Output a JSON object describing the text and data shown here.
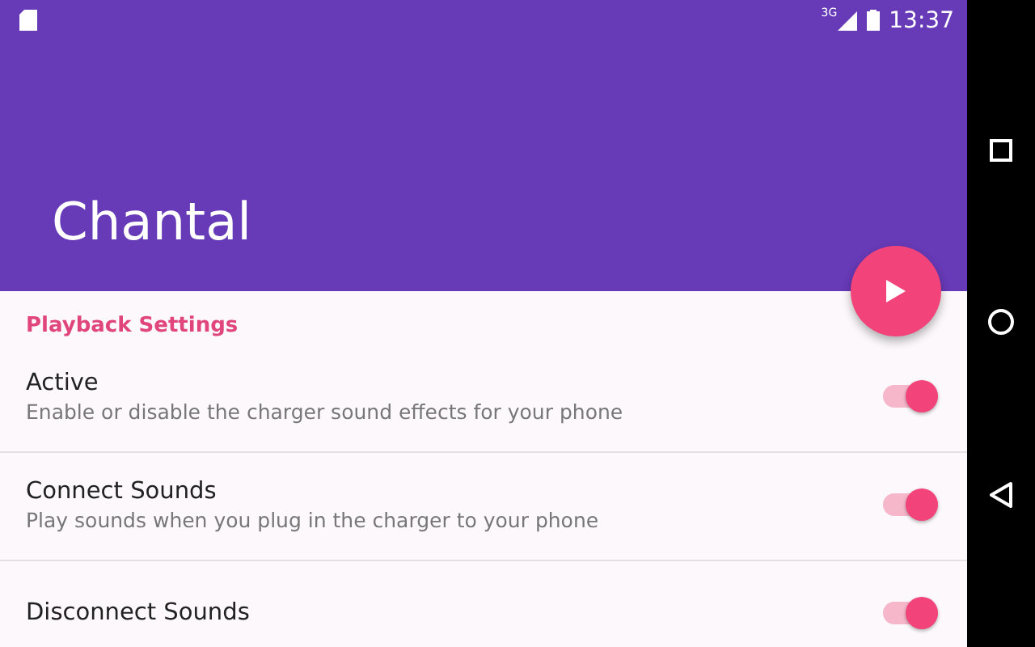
{
  "status_bar": {
    "time": "13:37",
    "network": "3G"
  },
  "app_bar": {
    "title": "Chantal"
  },
  "section": {
    "title": "Playback Settings"
  },
  "settings": [
    {
      "title": "Active",
      "summary": "Enable or disable the charger sound effects for your phone",
      "on": true
    },
    {
      "title": "Connect Sounds",
      "summary": "Play sounds when you plug in the charger to your phone",
      "on": true
    },
    {
      "title": "Disconnect Sounds",
      "on": true
    }
  ]
}
